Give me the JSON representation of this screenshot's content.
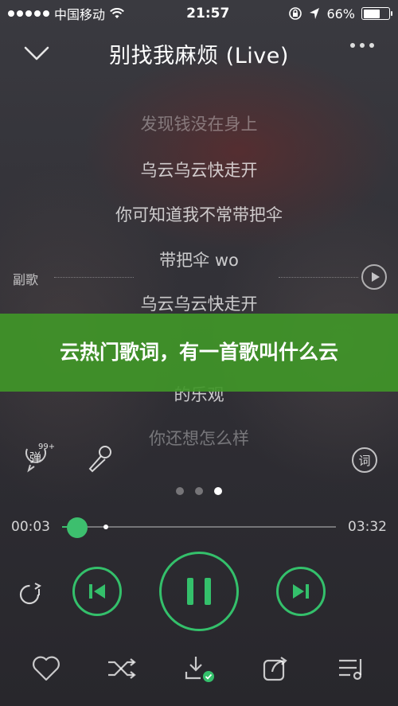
{
  "status_bar": {
    "carrier": "中国移动",
    "time": "21:57",
    "battery_percent": "66%",
    "battery_level": 0.66
  },
  "header": {
    "title": "别找我麻烦 (Live)"
  },
  "lyrics": [
    {
      "text": "发现钱没在身上"
    },
    {
      "text": "乌云乌云快走开"
    },
    {
      "text": "你可知道我不常带把伞"
    },
    {
      "text": "带把伞 wo"
    },
    {
      "text": "乌云乌云快走开"
    },
    {
      "text": "的乐观"
    },
    {
      "text": "你还想怎么样"
    }
  ],
  "side": {
    "label": "副歌"
  },
  "banner": {
    "text": "云热门歌词，有一首歌叫什么云"
  },
  "icons": {
    "danmu_char": "弹",
    "danmu_count": "99+",
    "lyric_char": "词"
  },
  "player": {
    "current_time": "00:03",
    "total_time": "03:32",
    "progress": 0.015,
    "accent_color": "#34c06b"
  },
  "pager": {
    "count": 3,
    "active_index": 2
  }
}
